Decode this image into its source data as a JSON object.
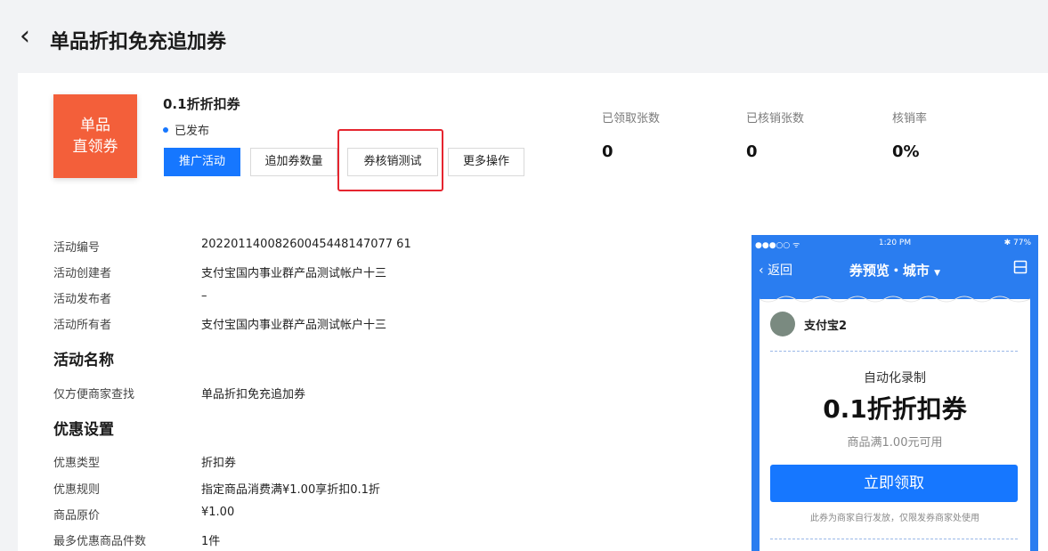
{
  "header": {
    "back_icon": "chevron-left-icon",
    "title": "单品折扣免充追加券"
  },
  "coupon": {
    "badge_line1": "单品",
    "badge_line2": "直领券",
    "name": "0.1折折扣券",
    "status": "已发布",
    "buttons": {
      "promote": "推广活动",
      "add_quantity": "追加券数量",
      "verify_test": "券核销测试",
      "more": "更多操作"
    }
  },
  "stats": [
    {
      "label": "已领取张数",
      "value": "0"
    },
    {
      "label": "已核销张数",
      "value": "0"
    },
    {
      "label": "核销率",
      "value": "0%"
    }
  ],
  "details": [
    {
      "label": "活动编号",
      "value": "20220114008260045448147077 61"
    },
    {
      "label": "活动创建者",
      "value": "支付宝国内事业群产品测试帐户十三"
    },
    {
      "label": "活动发布者",
      "value": "–"
    },
    {
      "label": "活动所有者",
      "value": "支付宝国内事业群产品测试帐户十三"
    }
  ],
  "sections": {
    "activity_name": {
      "title": "活动名称",
      "label": "仅方便商家查找",
      "value": "单品折扣免充追加券"
    },
    "discount": {
      "title": "优惠设置",
      "rows": [
        {
          "label": "优惠类型",
          "value": "折扣券"
        },
        {
          "label": "优惠规则",
          "value": "指定商品消费满¥1.00享折扣0.1折"
        },
        {
          "label": "商品原价",
          "value": "¥1.00"
        },
        {
          "label": "最多优惠商品件数",
          "value": "1件"
        }
      ]
    }
  },
  "phone": {
    "status_left": "●●●○○ ᯤ",
    "time": "1:20 PM",
    "status_right": "✱ 77%",
    "back": "返回",
    "nav_title": "券预览・城市",
    "menu_icon": "menu-icon",
    "merchant": "支付宝2",
    "subtitle": "自动化录制",
    "coupon_title": "0.1折折扣券",
    "condition": "商品满1.00元可用",
    "cta": "立即领取",
    "note": "此券为商家自行发放，仅限发券商家处使用"
  },
  "colors": {
    "accent": "#1677ff",
    "badge": "#f35f3a",
    "highlight": "#e5252f"
  }
}
